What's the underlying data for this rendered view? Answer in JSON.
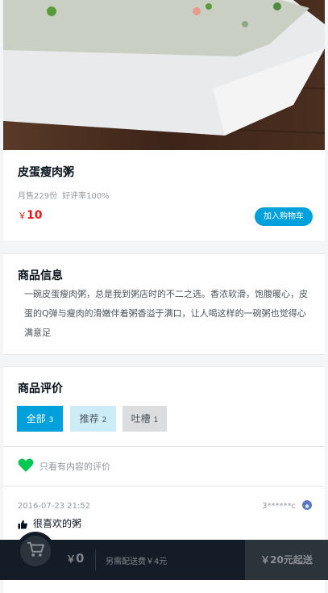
{
  "goods": {
    "name": "皮蛋瘦肉粥",
    "sell_count": "月售229份",
    "rating": "好评率100%",
    "price_currency": "￥",
    "price": "10",
    "add_cart_label": "加入购物车"
  },
  "info": {
    "title": "商品信息",
    "text": "一碗皮蛋瘦肉粥，总是我到粥店时的不二之选。香浓软滑，饱腹暖心，皮蛋的Q弹与瘦肉的滑嫩伴着粥香溢于满口，让人喝这样的一碗粥也觉得心满意足"
  },
  "ratings": {
    "title": "商品评价",
    "tabs": [
      {
        "label": "全部",
        "count": "3"
      },
      {
        "label": "推荐",
        "count": "2"
      },
      {
        "label": "吐槽",
        "count": "1"
      }
    ],
    "only_content_label": "只看有内容的评价",
    "items": [
      {
        "time": "2016-07-23 21:52",
        "user": "3******c",
        "text": "很喜欢的粥"
      }
    ]
  },
  "shopcart": {
    "total_currency": "￥",
    "total": "0",
    "delivery_desc": "另需配送费￥4元",
    "pay_label": "￥20元起送"
  },
  "colors": {
    "accent": "#00a0dc",
    "price": "#f01414",
    "heart": "#00c850",
    "cart_bar": "#141d27"
  }
}
